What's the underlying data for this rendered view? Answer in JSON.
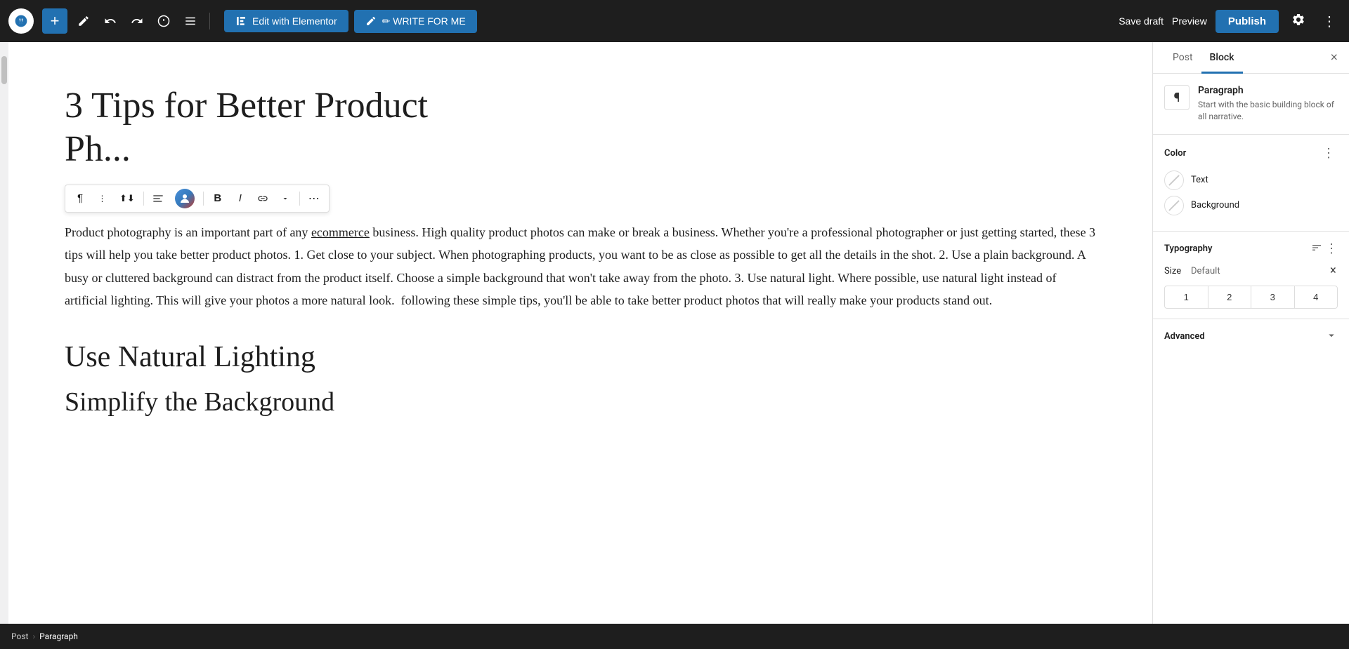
{
  "topBar": {
    "addLabel": "+",
    "editElementorLabel": "Edit with Elementor",
    "writeForMeLabel": "✏ WRITE FOR ME",
    "saveDraftLabel": "Save draft",
    "previewLabel": "Preview",
    "publishLabel": "Publish",
    "undoTitle": "Undo",
    "redoTitle": "Redo",
    "infoTitle": "View post",
    "listTitle": "List view"
  },
  "editor": {
    "postTitle": "3 Tips for Better Product Ph...",
    "postTitleLine1": "3 Tips for Better Product",
    "postTitleLine2": "Ph...",
    "paragraphText": "Product photography is an important part of any ecommerce business. High quality product photos can make or break a business. Whether you're a professional photographer or just getting started, these 3 tips will help you take better product photos. 1. Get close to your subject. When photographing products, you want to be as close as possible to get all the details in the shot. 2. Use a plain background. A busy or cluttered background can distract from the product itself. Choose a simple background that won't take away from the photo. 3. Use natural light. Where possible, use natural light instead of artificial lighting. This will give your photos a more natural look.  following these simple tips, you'll be able to take better product photos that will really make your products stand out.",
    "sectionHeading": "Use Natural Lighting",
    "partialHeading": "Simplify the Background",
    "ecommerceUnderline": "ecommerce"
  },
  "inlineToolbar": {
    "paragraphBtn": "¶",
    "dotsBtn": "⋮",
    "arrowsBtn": "⇅",
    "alignBtn": "≡",
    "boldBtn": "B",
    "italicBtn": "I",
    "linkBtn": "🔗",
    "moreBtn": "˅",
    "ellipsisBtn": "⋯"
  },
  "sidebar": {
    "postTab": "Post",
    "blockTab": "Block",
    "closeBtn": "×",
    "blockIcon": "¶",
    "blockName": "Paragraph",
    "blockDesc": "Start with the basic building block of all narrative.",
    "colorSection": {
      "title": "Color",
      "menuBtn": "⋮",
      "textLabel": "Text",
      "backgroundLabel": "Background"
    },
    "typographySection": {
      "title": "Typography",
      "menuBtn": "⋮",
      "adjustBtn": "⇄",
      "sizeLabel": "Size",
      "sizeValue": "Default",
      "fontSizes": [
        "1",
        "2",
        "3",
        "4"
      ]
    },
    "advancedSection": {
      "title": "Advanced",
      "chevron": "∨"
    }
  },
  "breadcrumb": {
    "postLabel": "Post",
    "separator": "›",
    "paragraphLabel": "Paragraph"
  }
}
